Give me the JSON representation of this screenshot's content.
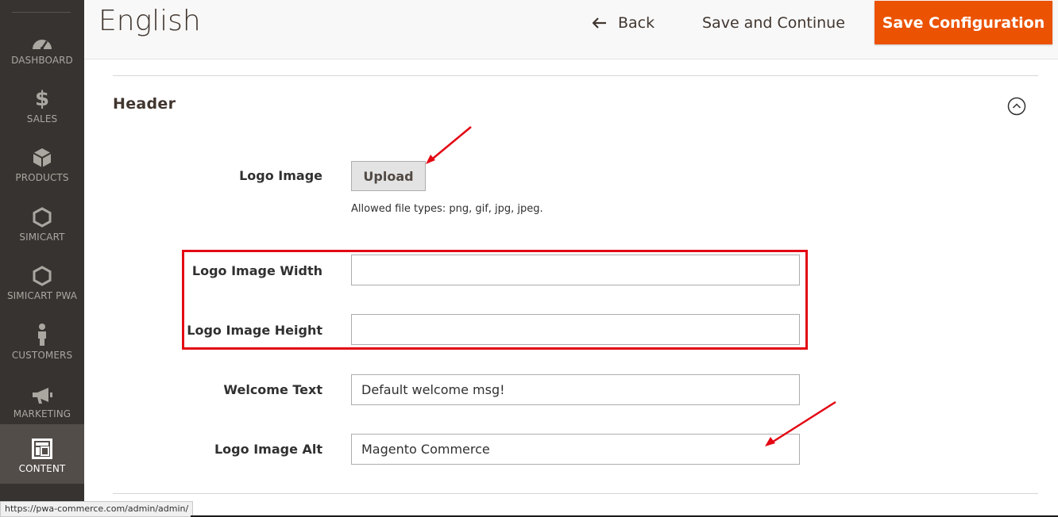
{
  "sidebar": {
    "items": [
      {
        "label": "DASHBOARD",
        "icon": "dashboard-gauge-icon"
      },
      {
        "label": "SALES",
        "icon": "dollar-icon"
      },
      {
        "label": "PRODUCTS",
        "icon": "cube-icon"
      },
      {
        "label": "SIMICART",
        "icon": "hexagon-icon"
      },
      {
        "label": "SIMICART PWA",
        "icon": "hexagon-icon"
      },
      {
        "label": "CUSTOMERS",
        "icon": "person-icon"
      },
      {
        "label": "MARKETING",
        "icon": "megaphone-icon"
      },
      {
        "label": "CONTENT",
        "icon": "layout-icon",
        "active": true
      }
    ]
  },
  "header": {
    "title": "English",
    "back_label": "Back",
    "save_continue_label": "Save and Continue",
    "save_config_label": "Save Configuration"
  },
  "section": {
    "title": "Header",
    "fields": {
      "logo_image": {
        "label": "Logo Image",
        "button": "Upload",
        "note": "Allowed file types: png, gif, jpg, jpeg."
      },
      "logo_width": {
        "label": "Logo Image Width",
        "value": ""
      },
      "logo_height": {
        "label": "Logo Image Height",
        "value": ""
      },
      "welcome_text": {
        "label": "Welcome Text",
        "value": "Default welcome msg!"
      },
      "logo_alt": {
        "label": "Logo Image Alt",
        "value": "Magento Commerce"
      }
    }
  },
  "status_bar": {
    "url": "https://pwa-commerce.com/admin/admin/"
  },
  "colors": {
    "sidebar_bg": "#373330",
    "sidebar_active": "#524d49",
    "primary_button": "#eb5202",
    "annotation": "#e30613"
  }
}
